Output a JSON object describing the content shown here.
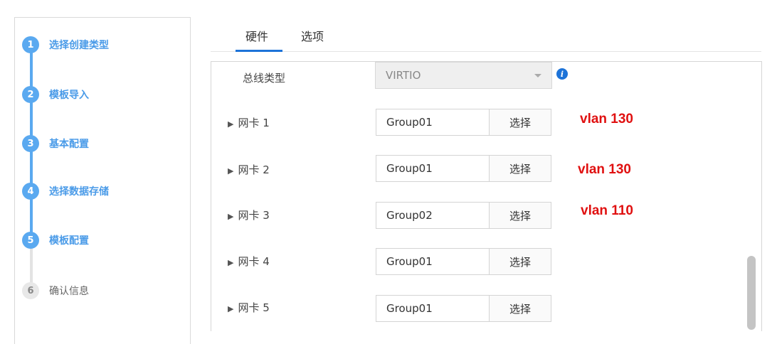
{
  "wizard": {
    "steps": [
      {
        "num": "1",
        "label": "选择创建类型",
        "active": true
      },
      {
        "num": "2",
        "label": "模板导入",
        "active": true
      },
      {
        "num": "3",
        "label": "基本配置",
        "active": true
      },
      {
        "num": "4",
        "label": "选择数据存储",
        "active": true
      },
      {
        "num": "5",
        "label": "模板配置",
        "active": true
      },
      {
        "num": "6",
        "label": "确认信息",
        "active": false
      }
    ]
  },
  "tabs": [
    {
      "label": "硬件",
      "selected": true
    },
    {
      "label": "选项",
      "selected": false
    }
  ],
  "bus": {
    "label": "总线类型",
    "value": "VIRTIO"
  },
  "nics": [
    {
      "label": "网卡 1",
      "group": "Group01",
      "button": "选择",
      "note": "vlan 130"
    },
    {
      "label": "网卡 2",
      "group": "Group01",
      "button": "选择",
      "note": "vlan 130"
    },
    {
      "label": "网卡 3",
      "group": "Group02",
      "button": "选择",
      "note": "vlan 110"
    },
    {
      "label": "网卡 4",
      "group": "Group01",
      "button": "选择",
      "note": ""
    },
    {
      "label": "网卡 5",
      "group": "Group01",
      "button": "选择",
      "note": ""
    }
  ],
  "icons": {
    "info": "info-icon",
    "expand": "triangle-right-icon",
    "caret": "chevron-down-icon"
  },
  "colors": {
    "accent": "#5aa9f0",
    "tab_underline": "#1d73d8",
    "annotation": "#e01010"
  }
}
